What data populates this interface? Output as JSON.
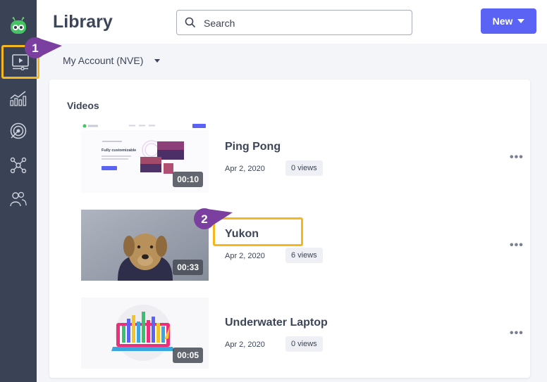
{
  "header": {
    "title": "Library",
    "search_placeholder": "Search",
    "new_button": "New"
  },
  "account": {
    "label": "My Account (NVE)"
  },
  "section": {
    "title": "Videos"
  },
  "videos": [
    {
      "title": "Ping Pong",
      "date": "Apr 2, 2020",
      "views": "0 views",
      "duration": "00:10",
      "thumb_text": "Fully customizable"
    },
    {
      "title": "Yukon",
      "date": "Apr 2, 2020",
      "views": "6 views",
      "duration": "00:33"
    },
    {
      "title": "Underwater Laptop",
      "date": "Apr 2, 2020",
      "views": "0 views",
      "duration": "00:05"
    }
  ],
  "more_label": "•••",
  "steps": [
    "1",
    "2"
  ],
  "colors": {
    "sidebar": "#3a4356",
    "accent": "#5b63f5",
    "highlight": "#f4b81c",
    "step_badge": "#7b3fa0"
  },
  "icons": [
    "robot-logo-icon",
    "video-library-icon",
    "analytics-icon",
    "target-icon",
    "network-icon",
    "users-icon",
    "search-icon",
    "caret-down-icon",
    "more-icon"
  ]
}
